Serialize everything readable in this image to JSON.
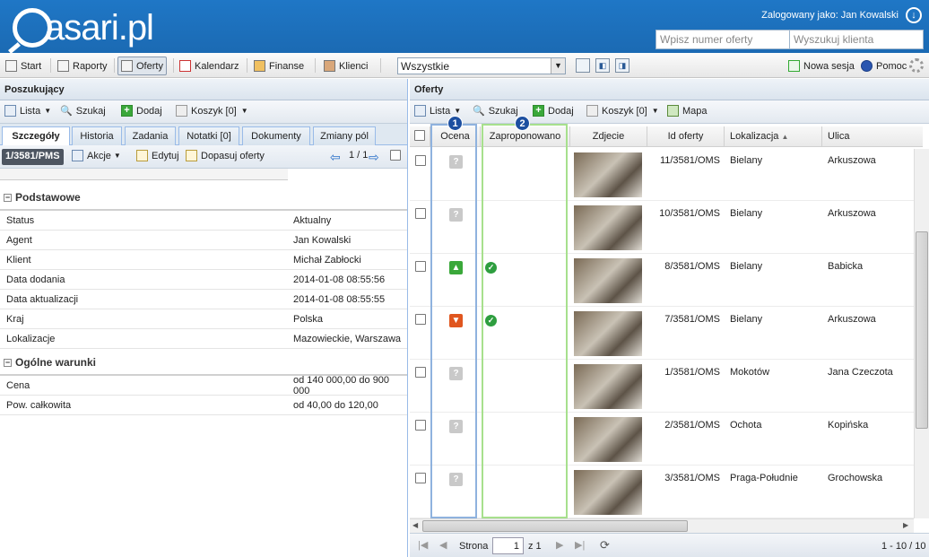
{
  "header": {
    "logo": "asari.pl",
    "logged_label": "Zalogowany jako: Jan Kowalski",
    "offer_input_placeholder": "Wpisz numer oferty",
    "client_input_placeholder": "Wyszukuj klienta"
  },
  "toolbar": {
    "start": "Start",
    "raporty": "Raporty",
    "oferty": "Oferty",
    "kalendarz": "Kalendarz",
    "finanse": "Finanse",
    "klienci": "Klienci",
    "filter_select": "Wszystkie",
    "nowa_sesja": "Nowa sesja",
    "pomoc": "Pomoc"
  },
  "left": {
    "title": "Poszukujący",
    "lista": "Lista",
    "szukaj": "Szukaj",
    "dodaj": "Dodaj",
    "koszyk": "Koszyk [0]",
    "tabs": [
      "Szczegóły",
      "Historia",
      "Zadania",
      "Notatki [0]",
      "Dokumenty",
      "Zmiany pól"
    ],
    "record_id": "1/3581/PMS",
    "akcje": "Akcje",
    "edytuj": "Edytuj",
    "dopasuj": "Dopasuj oferty",
    "record_nav": "1 / 1",
    "section_basic": "Podstawowe",
    "basic_rows": [
      {
        "k": "Status",
        "v": "Aktualny"
      },
      {
        "k": "Agent",
        "v": "Jan Kowalski"
      },
      {
        "k": "Klient",
        "v": "Michał Zabłocki"
      },
      {
        "k": "Data dodania",
        "v": "2014-01-08 08:55:56"
      },
      {
        "k": "Data aktualizacji",
        "v": "2014-01-08 08:55:55"
      },
      {
        "k": "Kraj",
        "v": "Polska"
      },
      {
        "k": "Lokalizacje",
        "v": "Mazowieckie, Warszawa"
      }
    ],
    "section_terms": "Ogólne warunki",
    "terms_rows": [
      {
        "k": "Cena",
        "v": "od 140 000,00 do 900 000"
      },
      {
        "k": "Pow. całkowita",
        "v": "od 40,00 do 120,00"
      }
    ]
  },
  "right": {
    "title": "Oferty",
    "lista": "Lista",
    "szukaj": "Szukaj",
    "dodaj": "Dodaj",
    "koszyk": "Koszyk [0]",
    "mapa": "Mapa",
    "columns": {
      "ocena": "Ocena",
      "zaproponowano": "Zaproponowano",
      "zdjecie": "Zdjecie",
      "id": "Id oferty",
      "lokalizacja": "Lokalizacja",
      "ulica": "Ulica"
    },
    "badge1": "1",
    "badge2": "2",
    "rows": [
      {
        "rating": "?",
        "proposed": false,
        "id": "11/3581/OMS",
        "loc": "Bielany",
        "street": "Arkuszowa"
      },
      {
        "rating": "?",
        "proposed": false,
        "id": "10/3581/OMS",
        "loc": "Bielany",
        "street": "Arkuszowa"
      },
      {
        "rating": "up",
        "proposed": true,
        "id": "8/3581/OMS",
        "loc": "Bielany",
        "street": "Babicka"
      },
      {
        "rating": "down",
        "proposed": true,
        "id": "7/3581/OMS",
        "loc": "Bielany",
        "street": "Arkuszowa"
      },
      {
        "rating": "?",
        "proposed": false,
        "id": "1/3581/OMS",
        "loc": "Mokotów",
        "street": "Jana Czeczota"
      },
      {
        "rating": "?",
        "proposed": false,
        "id": "2/3581/OMS",
        "loc": "Ochota",
        "street": "Kopińska"
      },
      {
        "rating": "?",
        "proposed": false,
        "id": "3/3581/OMS",
        "loc": "Praga-Południe",
        "street": "Grochowska"
      }
    ],
    "pager": {
      "strona": "Strona",
      "page": "1",
      "of": "z 1",
      "range": "1 - 10 / 10"
    }
  }
}
